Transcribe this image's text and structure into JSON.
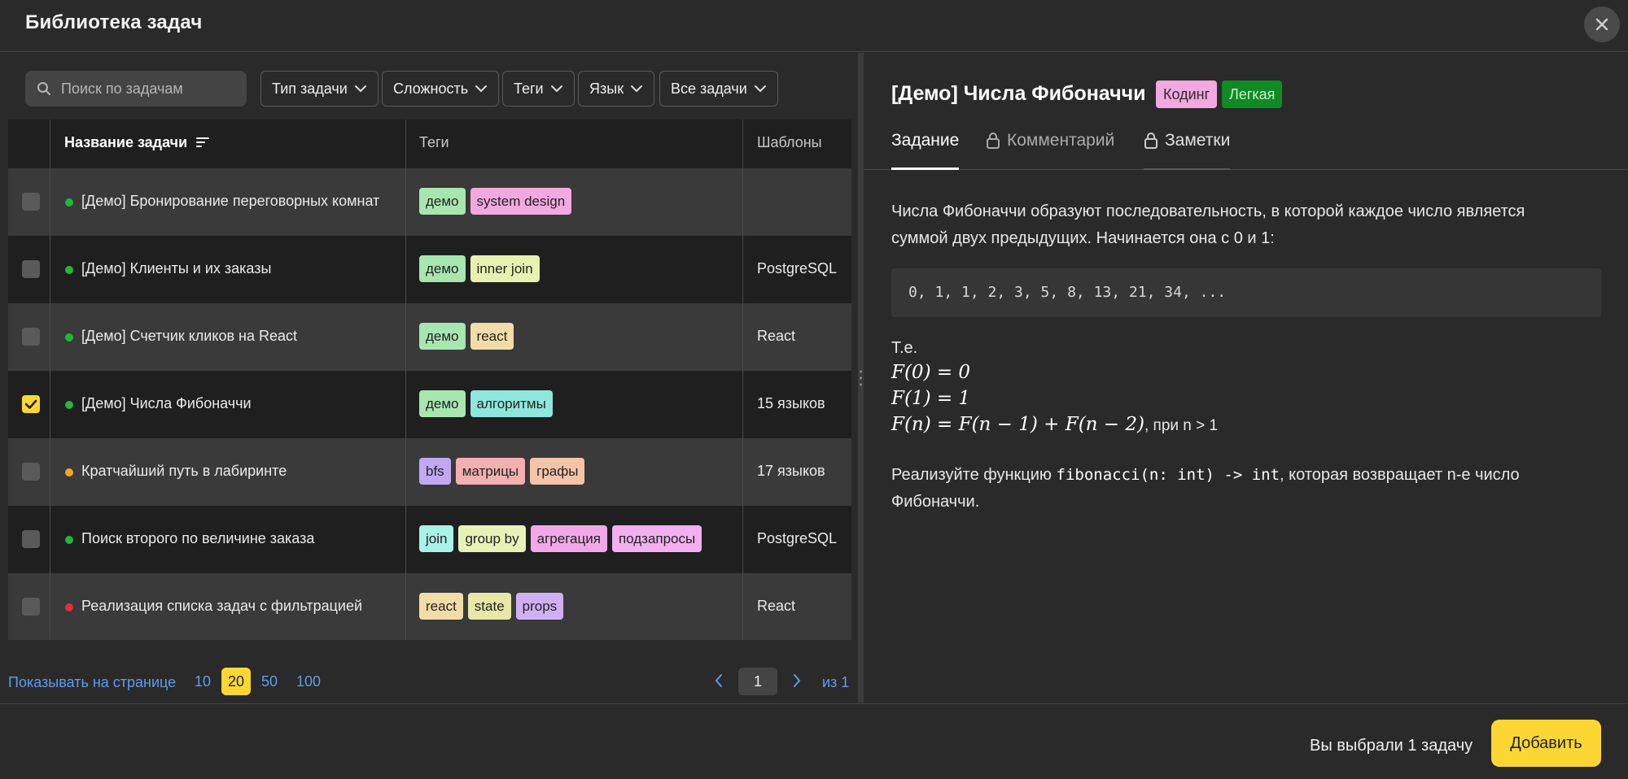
{
  "header": {
    "title": "Библиотека задач"
  },
  "search": {
    "placeholder": "Поиск по задачам"
  },
  "filters": [
    "Тип задачи",
    "Сложность",
    "Теги",
    "Язык",
    "Все задачи"
  ],
  "table": {
    "columns": {
      "name": "Название задачи",
      "tags": "Теги",
      "templates": "Шаблоны"
    },
    "rows": [
      {
        "name": "[Демо] Бронирование переговорных комнат",
        "status": "green",
        "checked": false,
        "tags": [
          "демо",
          "system design"
        ],
        "templates": ""
      },
      {
        "name": "[Демо] Клиенты и их заказы",
        "status": "green",
        "checked": false,
        "tags": [
          "демо",
          "inner join"
        ],
        "templates": "PostgreSQL"
      },
      {
        "name": "[Демо] Счетчик кликов на React",
        "status": "green",
        "checked": false,
        "tags": [
          "демо",
          "react"
        ],
        "templates": "React"
      },
      {
        "name": "[Демо] Числа Фибоначчи",
        "status": "green",
        "checked": true,
        "tags": [
          "демо",
          "алгоритмы"
        ],
        "templates": "15 языков"
      },
      {
        "name": "Кратчайший путь в лабиринте",
        "status": "orange",
        "checked": false,
        "tags": [
          "bfs",
          "матрицы",
          "графы"
        ],
        "templates": "17 языков"
      },
      {
        "name": "Поиск второго по величине заказа",
        "status": "green",
        "checked": false,
        "tags": [
          "join",
          "group by",
          "агрегация",
          "подзапросы"
        ],
        "templates": "PostgreSQL"
      },
      {
        "name": "Реализация списка задач с фильтрацией",
        "status": "red",
        "checked": false,
        "tags": [
          "react",
          "state",
          "props"
        ],
        "templates": "React"
      }
    ]
  },
  "tag_colors": {
    "демо": "#a8e6b0",
    "system design": "#f2a8e0",
    "inner join": "#e8f2b0",
    "react": "#f2dca8",
    "алгоритмы": "#8fe6dc",
    "bfs": "#c0a8f2",
    "матрицы": "#f2b0b0",
    "графы": "#f2c4a8",
    "join": "#a8f2e6",
    "group by": "#e8f2b8",
    "агрегация": "#f2a8e8",
    "подзапросы": "#f2b0f0",
    "state": "#e8e8a8",
    "props": "#d0b0f2"
  },
  "status_colors": {
    "green": "#1fb83a",
    "orange": "#f5a623",
    "red": "#e0303a"
  },
  "pagination": {
    "label": "Показывать на странице",
    "sizes": [
      "10",
      "20",
      "50",
      "100"
    ],
    "selected_size": "20",
    "current_page": "1",
    "of_label": "из 1"
  },
  "detail": {
    "title": "[Демо] Числа Фибоначчи",
    "badges": [
      {
        "label": "Кодинг",
        "bg": "#f2a8e0",
        "fg": "#2a2a2a"
      },
      {
        "label": "Легкая",
        "bg": "#0f8a24",
        "fg": "#c8f0c8"
      }
    ],
    "tabs": [
      "Задание",
      "Комментарий",
      "Заметки"
    ],
    "intro_1": "Числа Фибоначчи образуют последовательность, в которой каждое число является",
    "intro_2": "суммой двух предыдущих. Начинается она с 0 и 1:",
    "sequence": "0, 1, 1, 2, 3, 5, 8, 13, 21, 34, ...",
    "te": "Т.е.",
    "f0": "F(0) = 0",
    "f1": "F(1) = 1",
    "fn": "F(n) = F(n − 1) + F(n − 2)",
    "fn_tail": ", при n > 1",
    "impl_prefix": "Реализуйте функцию ",
    "impl_code": "fibonacci(n: int) -> int",
    "impl_suffix": ", которая возвращает n-е число",
    "impl_2": "Фибоначчи."
  },
  "footer": {
    "selected_text": "Вы выбрали 1 задачу",
    "add_label": "Добавить"
  }
}
